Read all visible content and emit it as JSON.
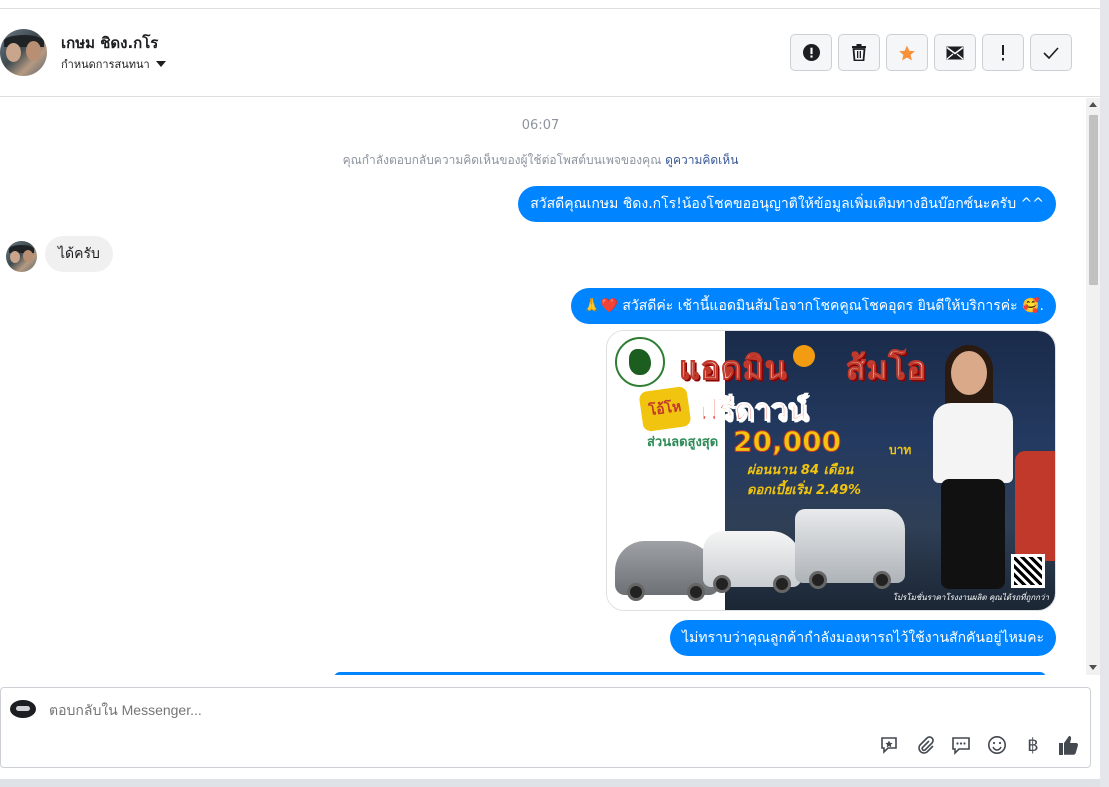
{
  "header": {
    "contact_name": "เกษม ชิดง.กโร",
    "assign_label": "กำหนดการสนทนา",
    "toolbar": [
      {
        "name": "report-spam",
        "icon": "alert-circle-icon"
      },
      {
        "name": "delete",
        "icon": "trash-icon"
      },
      {
        "name": "star",
        "icon": "star-icon"
      },
      {
        "name": "mark-unread",
        "icon": "envelope-icon"
      },
      {
        "name": "important",
        "icon": "exclamation-icon"
      },
      {
        "name": "done",
        "icon": "check-icon"
      }
    ],
    "star_color": "#f7923b"
  },
  "conversation": {
    "timestamp": "06:07",
    "notice_text": "คุณกำลังตอบกลับความคิดเห็นของผู้ใช้ต่อโพสต์บนเพจของคุณ",
    "notice_link": "ดูความคิดเห็น",
    "messages": [
      {
        "from": "page",
        "text": "สวัสดีคุณเกษม ชิดง.กโร!น้องโชคขออนุญาติให้ข้อมูลเพิ่มเติมทางอินบ๊อกซ์นะครับ ^^"
      },
      {
        "from": "user",
        "text": "ได้ครับ"
      },
      {
        "from": "page",
        "text": "🙏❤️ สวัสดีค่ะ เช้านี้แอดมินส้มโอจากโชคคูณโชคอุดร ยินดีให้บริการค่ะ 🥰."
      },
      {
        "from": "page",
        "text": "ไม่ทราบว่าคุณลูกค้ากำลังมองหารถไว้ใช้งานสักคันอยู่ไหมคะ"
      }
    ],
    "promo_image": {
      "headline": "แอดมิน",
      "headline_name": "ส้มโอ",
      "offer_badge": "โอ้โห",
      "free_down": "ฟรีดาวน์",
      "discount_label": "ส่วนลดสูงสุด",
      "discount_amount": "20,000",
      "currency": "บาท",
      "installment": "ผ่อนนาน 84 เดือน",
      "interest": "ดอกเบี้ยเริ่ม 2.49%",
      "footer": "โปรโมชั่นราคาโรงงานผลิต คุณได้รถที่ถูกกว่า"
    },
    "bubble_color": "#0084ff"
  },
  "composer": {
    "placeholder": "ตอบกลับใน Messenger...",
    "icons": [
      "saved-reply-icon",
      "attachment-icon",
      "quick-reply-icon",
      "emoji-icon",
      "baht-icon",
      "thumbs-up-icon"
    ]
  }
}
